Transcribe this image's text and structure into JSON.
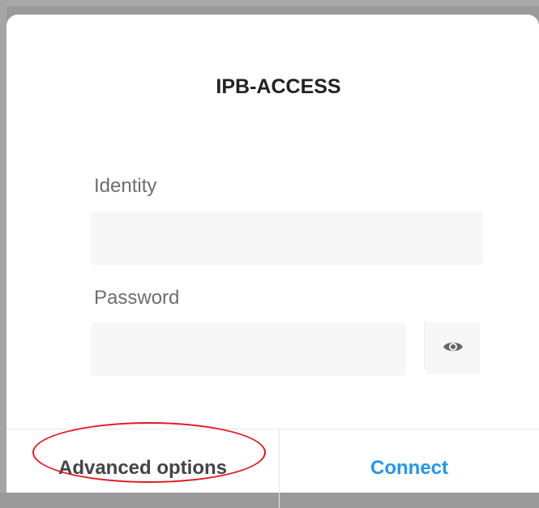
{
  "dialog": {
    "title": "IPB-ACCESS",
    "identity": {
      "label": "Identity",
      "value": ""
    },
    "password": {
      "label": "Password",
      "value": "",
      "toggle_icon": "eye-icon"
    },
    "buttons": {
      "advanced": "Advanced options",
      "connect": "Connect"
    },
    "accent_color": "#2196f3",
    "annotation_color": "#e4161e"
  }
}
